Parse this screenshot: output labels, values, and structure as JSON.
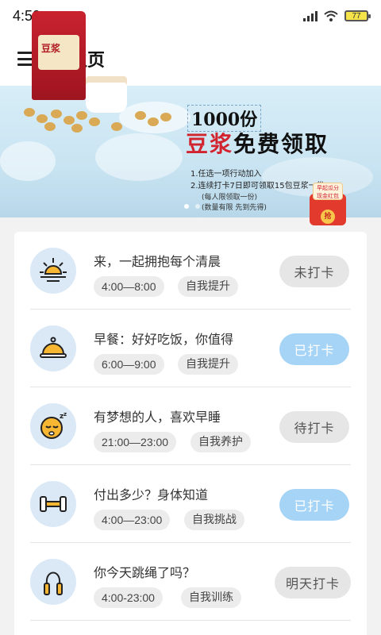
{
  "status_bar": {
    "time": "4:59",
    "battery": "77"
  },
  "header": {
    "title": "主页",
    "menu_icon": "hamburger-menu-icon"
  },
  "banner": {
    "count": "1000份",
    "title_red": "豆浆",
    "title_black": "免费领取",
    "rule_1": "1.任选一项行动加入",
    "rule_2": "2.连续打卡7日即可领取15包豆浆一份",
    "note_1": "(每人限领取一份)",
    "note_2": "(数量有限  先到先得)",
    "product_text": "豆浆",
    "redpacket_text": "早起瓜分 现金红包",
    "redpacket_coin": "抢",
    "slides": 2,
    "active_slide": 1
  },
  "tasks": [
    {
      "icon": "sunrise-icon",
      "title": "来，一起拥抱每个清晨",
      "time": "4:00—8:00",
      "category": "自我提升",
      "action": "未打卡",
      "status": "gray"
    },
    {
      "icon": "food-cloche-icon",
      "title": "早餐：好好吃饭，你值得",
      "time": "6:00—9:00",
      "category": "自我提升",
      "action": "已打卡",
      "status": "blue"
    },
    {
      "icon": "sleeping-face-icon",
      "title": "有梦想的人，喜欢早睡",
      "time": "21:00—23:00",
      "category": "自我养护",
      "action": "待打卡",
      "status": "gray"
    },
    {
      "icon": "dumbbell-icon",
      "title": "付出多少？身体知道",
      "time": "4:00—23:00",
      "category": "自我挑战",
      "action": "已打卡",
      "status": "blue"
    },
    {
      "icon": "jump-rope-icon",
      "title": "你今天跳绳了吗？",
      "time": "4:00-23:00",
      "category": "自我训练",
      "action": "明天打卡",
      "status": "gray"
    }
  ]
}
